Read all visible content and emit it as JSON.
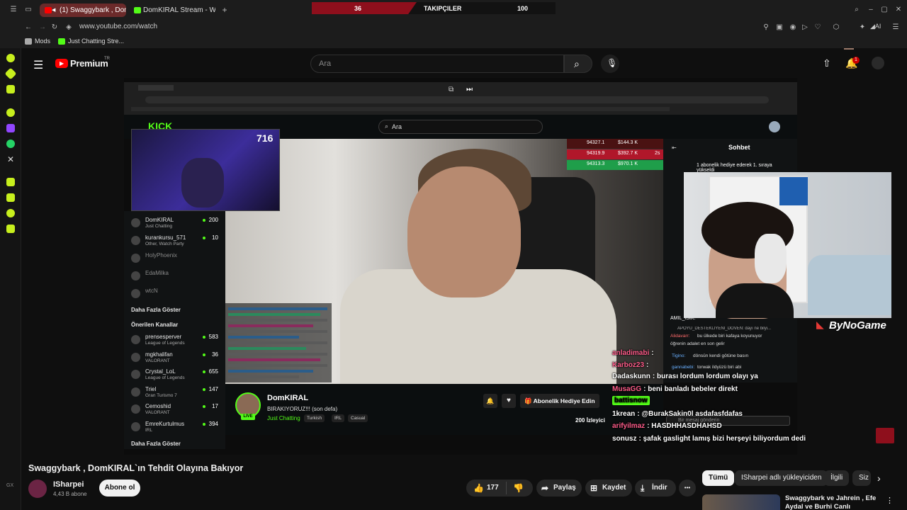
{
  "browser": {
    "tabs": [
      {
        "label": "(1) Swaggybark , Dom",
        "active": true
      },
      {
        "label": "DomKIRAL Stream - Watc",
        "active": false
      }
    ],
    "new_tab_label": "+",
    "url": "www.youtube.com/watch",
    "bookmarks": [
      "Mods",
      "Just Chatting Stre..."
    ]
  },
  "follow_overlay": {
    "left_count": "36",
    "label": "TAKIPÇILER",
    "right_count": "100"
  },
  "youtube": {
    "logo": "Premium",
    "logo_sup": "TR",
    "search_placeholder": "Ara",
    "notif_count": "1"
  },
  "inner": {
    "search_placeholder": "Ara",
    "cam_count": "716",
    "chat_title": "Sohbet",
    "donations": [
      {
        "amount": "94327.1",
        "total": "$144.3 K"
      },
      {
        "amount": "94319.9",
        "total": "$392.7 K",
        "age": "2s"
      },
      {
        "amount": "94313.3",
        "total": "$970.1 K"
      }
    ],
    "followed": [
      {
        "name": "DomKIRAL",
        "sub": "Just Chatting",
        "count": "200"
      },
      {
        "name": "kurankursu_571",
        "sub": "Other, Watch Party",
        "count": "10"
      },
      {
        "name": "HolyPhoenix",
        "sub": "",
        "count": ""
      },
      {
        "name": "EdaMilka",
        "sub": "",
        "count": ""
      },
      {
        "name": "wtcN",
        "sub": "",
        "count": ""
      }
    ],
    "show_more": "Daha Fazla Göster",
    "recommended_title": "Önerilen Kanallar",
    "recommended": [
      {
        "name": "prensesperver",
        "sub": "League of Legends",
        "count": "583"
      },
      {
        "name": "mgkhalifan",
        "sub": "VALORANT",
        "count": "36"
      },
      {
        "name": "Crystal_LoL",
        "sub": "League of Legends",
        "count": "655"
      },
      {
        "name": "Triel",
        "sub": "Gran Turismo 7",
        "count": "147"
      },
      {
        "name": "Cemoshid",
        "sub": "VALORANT",
        "count": "17"
      },
      {
        "name": "EmreKurtulmus",
        "sub": "IRL",
        "count": "394"
      }
    ],
    "show_more_2": "Daha Fazla Göster",
    "channel_name": "DomKIRAL",
    "stream_title": "BIRAKIYORUZ!!! (son defa)",
    "category": "Just Chatting",
    "tags": [
      "Turkish",
      "IRL",
      "Casual"
    ],
    "gift_label": "Abonelik Hediye Edin",
    "viewers": "200",
    "viewers_label": "İzleyici",
    "right_chat_lines": [
      {
        "user": "",
        "text": "1 abonelik hediye ederek 1. sıraya yükseldi"
      },
      {
        "user": "AMIL_ISIK:",
        "text": ""
      },
      {
        "user": "",
        "text": "APOYU_DESTEKLIYENI_DOVEN: dayı ne bilyi..."
      },
      {
        "user": "Alidavarr:",
        "text": "bu ülkede biri kafaya koyunuyor"
      },
      {
        "user": "",
        "text": "öğrenin adalet en son gelir"
      },
      {
        "user": "Tigino:",
        "text": "dönsün kendi götüne basın"
      },
      {
        "user": "gannabebi:",
        "text": "torwak ildyüzü biri abi"
      }
    ],
    "chat_send_placeholder": "Bir mesaj gönderin"
  },
  "overlay_chat": [
    {
      "user": "anladimabi",
      "text": ":",
      "color": "#ff5c8a"
    },
    {
      "user": "Karboz23",
      "text": ":",
      "color": "#ff5c8a"
    },
    {
      "user": "Dadaskunn",
      "text": ": burası lordum lordum olayı ya",
      "color": "#ffffff"
    },
    {
      "user": "MusaGG",
      "text": ": beni banladı bebeler direkt",
      "color": "#ff5c8a"
    },
    {
      "user": "battisnow",
      "text": "",
      "color": "#53fc18"
    },
    {
      "user": "1krean",
      "text": ": @BurakSakin0l asdafasfdafas",
      "color": "#ffffff"
    },
    {
      "user": "arifyilmaz",
      "text": ": HASDHHASDHAHSD",
      "color": "#ff5c8a"
    },
    {
      "user": "sonusz",
      "text": ": şafak gaslight lamış bizi herşeyi biliyordum dedi",
      "color": "#ffffff"
    }
  ],
  "bynogame": "ByNoGame",
  "video_info": {
    "title": "Swaggybark , DomKIRAL`ın Tehdit Olayına Bakıyor",
    "channel": "ISharpei",
    "subs": "4,43 B abone",
    "subscribe": "Abone ol",
    "likes": "177",
    "share": "Paylaş",
    "save": "Kaydet",
    "download": "İndir",
    "more": "•••"
  },
  "related": {
    "chips": [
      "Tümü",
      "ISharpei adlı yükleyiciden",
      "İlgili",
      "Siz"
    ],
    "first_title": "Swaggybark ve Jahrein , Efe Aydal ve Burhi Canlı Yayında"
  },
  "colors": {
    "accent_red": "#ff0000",
    "kick_green": "#53fc18",
    "dark": "#0f0f0f"
  }
}
